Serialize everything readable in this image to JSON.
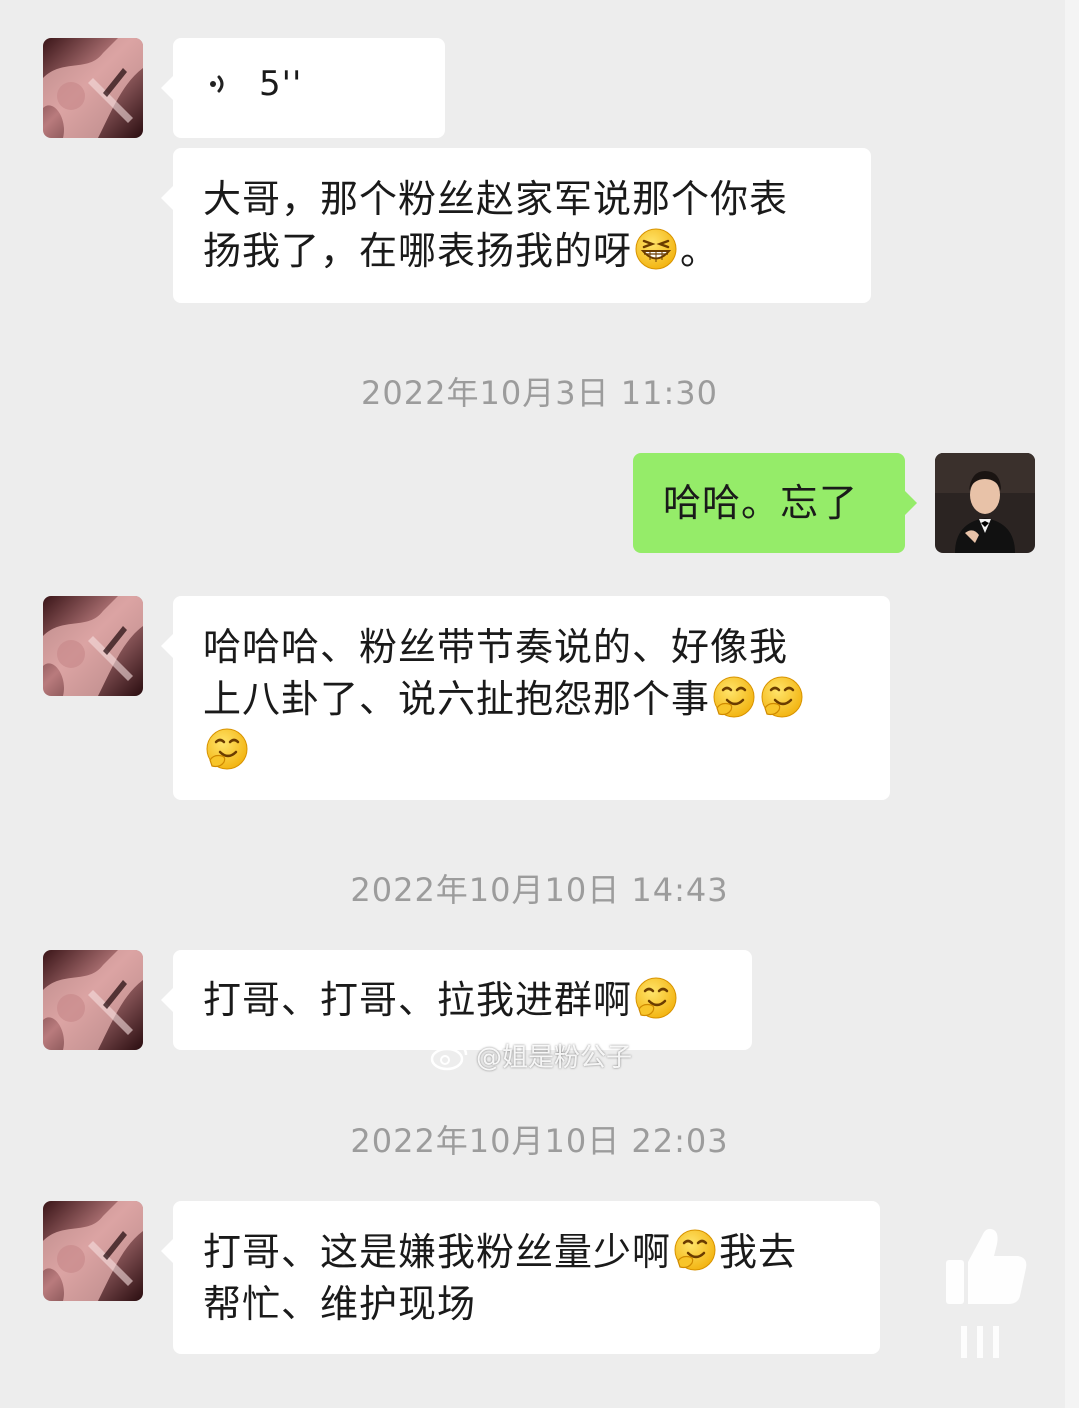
{
  "messages": {
    "m1": {
      "voice_duration": "5''"
    },
    "m2": {
      "line1": "大哥，那个粉丝赵家军说那个你表",
      "line2": "扬我了，在哪表扬我的呀",
      "line2_end": "。"
    },
    "m3": {
      "text": "哈哈。忘了"
    },
    "m4": {
      "line1": "哈哈哈、粉丝带节奏说的、好像我",
      "line2": "上八卦了、说六扯抱怨那个事"
    },
    "m5": {
      "text": "打哥、打哥、拉我进群啊"
    },
    "m6": {
      "line1_a": "打哥、这是嫌我粉丝量少啊",
      "line1_b": "我去",
      "line2": "帮忙、维护现场"
    }
  },
  "timestamps": {
    "t1": "2022年10月3日 11:30",
    "t2": "2022年10月10日 14:43",
    "t3": "2022年10月10日 22:03"
  },
  "watermark": {
    "text": "@姐是粉公子"
  },
  "icons": {
    "voice": "voice-wave-icon",
    "grin": "grinning-emoji-icon",
    "smirk": "smirk-emoji-icon",
    "like": "thumbs-up-icon",
    "weibo": "weibo-logo-icon"
  },
  "colors": {
    "background": "#ededed",
    "incoming_bubble": "#ffffff",
    "outgoing_bubble": "#95ec69",
    "timestamp_text": "#9c9c9c",
    "message_text": "#1a1a1a"
  }
}
